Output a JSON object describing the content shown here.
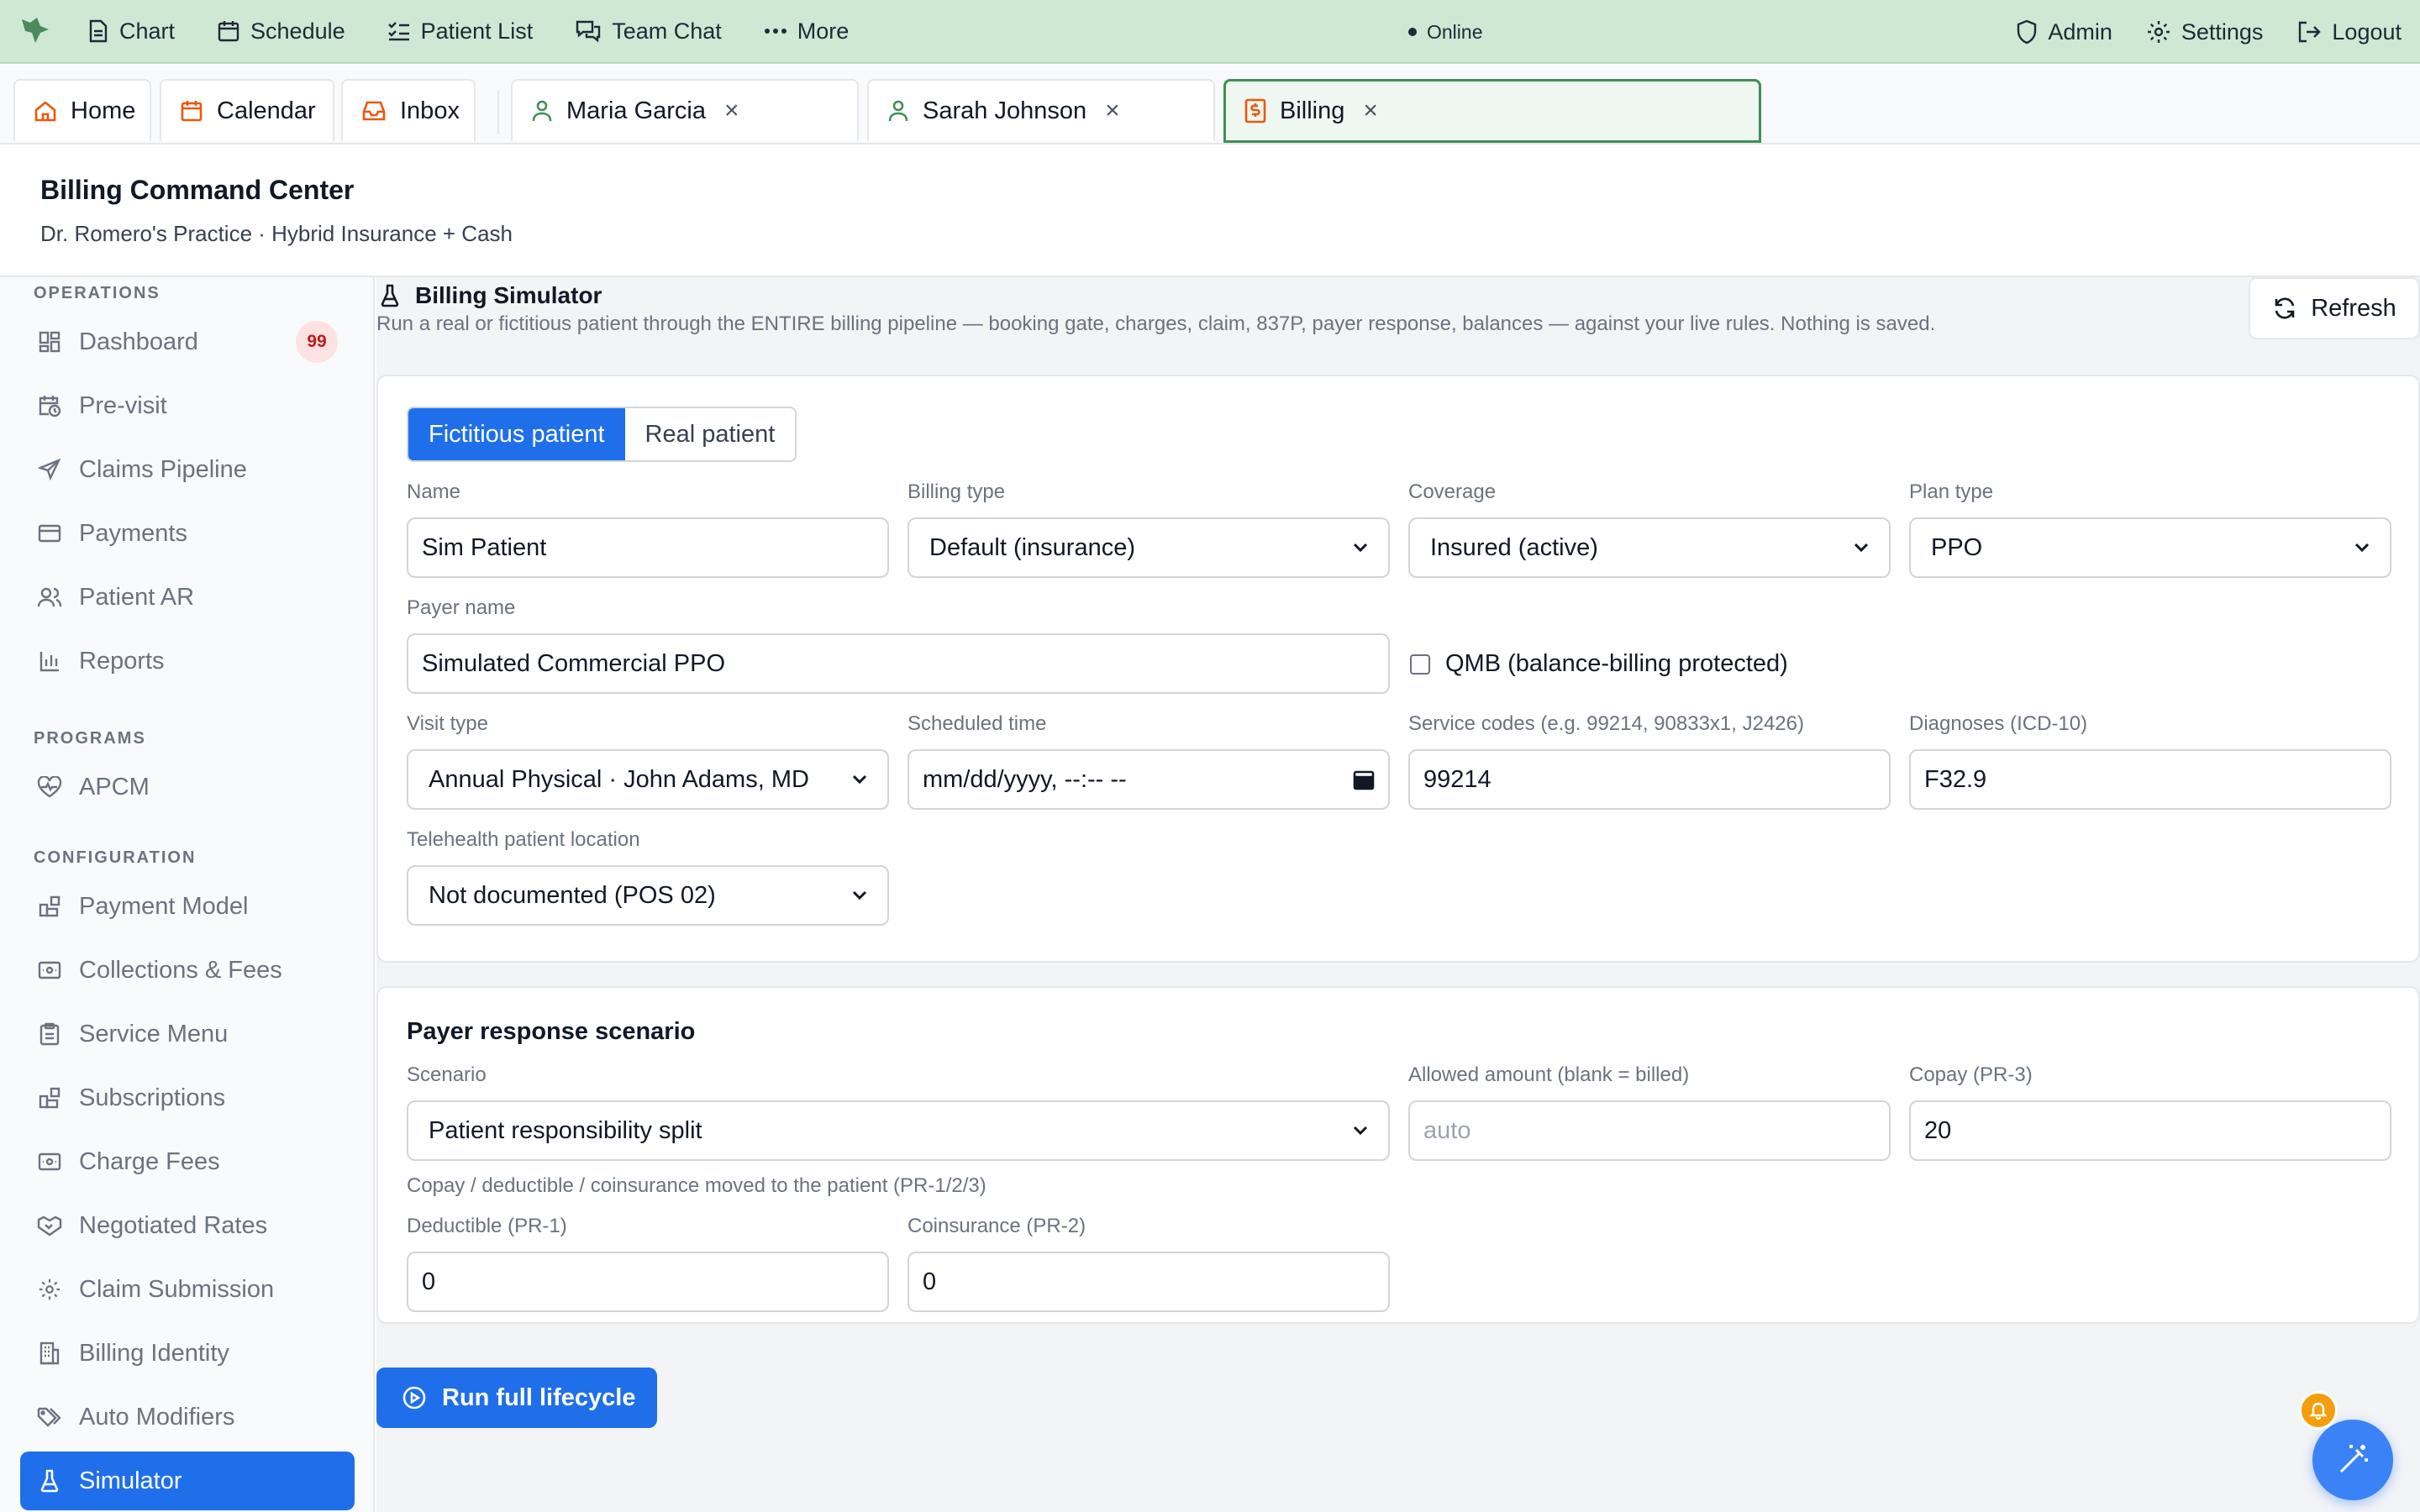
{
  "topnav": {
    "items": [
      {
        "label": "Chart",
        "icon": "document-icon"
      },
      {
        "label": "Schedule",
        "icon": "calendar-icon"
      },
      {
        "label": "Patient List",
        "icon": "list-icon"
      },
      {
        "label": "Team Chat",
        "icon": "chat-icon"
      },
      {
        "label": "More",
        "icon": "dots-icon"
      }
    ],
    "status": "Online",
    "right": [
      {
        "label": "Admin",
        "icon": "shield-icon"
      },
      {
        "label": "Settings",
        "icon": "gear-icon"
      },
      {
        "label": "Logout",
        "icon": "logout-icon"
      }
    ]
  },
  "tabs": {
    "home": "Home",
    "calendar": "Calendar",
    "inbox": "Inbox",
    "patient1": "Maria Garcia",
    "patient2": "Sarah Johnson",
    "billing": "Billing",
    "close": "×"
  },
  "header": {
    "title": "Billing Command Center",
    "subtitle": "Dr. Romero's Practice · Hybrid Insurance + Cash"
  },
  "sidebar": {
    "sections": {
      "operations": "OPERATIONS",
      "programs": "PROGRAMS",
      "configuration": "CONFIGURATION"
    },
    "items": {
      "dashboard": "Dashboard",
      "dashboard_badge": "99",
      "previsit": "Pre-visit",
      "claims": "Claims Pipeline",
      "payments": "Payments",
      "patient_ar": "Patient AR",
      "reports": "Reports",
      "apcm": "APCM",
      "payment_model": "Payment Model",
      "collections": "Collections & Fees",
      "service_menu": "Service Menu",
      "subscriptions": "Subscriptions",
      "charge_fees": "Charge Fees",
      "negotiated_rates": "Negotiated Rates",
      "claim_submission": "Claim Submission",
      "billing_identity": "Billing Identity",
      "auto_modifiers": "Auto Modifiers",
      "simulator": "Simulator"
    }
  },
  "simulator": {
    "title": "Billing Simulator",
    "description": "Run a real or fictitious patient through the ENTIRE billing pipeline — booking gate, charges, claim, 837P, payer response, balances — against your live rules. Nothing is saved.",
    "refresh": "Refresh",
    "toggle": {
      "fictitious": "Fictitious patient",
      "real": "Real patient"
    },
    "fields": {
      "name": {
        "label": "Name",
        "value": "Sim Patient"
      },
      "billing_type": {
        "label": "Billing type",
        "value": "Default (insurance)"
      },
      "coverage": {
        "label": "Coverage",
        "value": "Insured (active)"
      },
      "plan_type": {
        "label": "Plan type",
        "value": "PPO"
      },
      "payer_name": {
        "label": "Payer name",
        "value": "Simulated Commercial PPO"
      },
      "qmb": {
        "label": "QMB (balance-billing protected)"
      },
      "visit_type": {
        "label": "Visit type",
        "value": "Annual Physical · John Adams, MD"
      },
      "scheduled_time": {
        "label": "Scheduled time",
        "value": "mm/dd/yyyy, --:-- --"
      },
      "service_codes": {
        "label": "Service codes (e.g. 99214, 90833x1, J2426)",
        "value": "99214"
      },
      "diagnoses": {
        "label": "Diagnoses (ICD-10)",
        "value": "F32.9"
      },
      "telehealth": {
        "label": "Telehealth patient location",
        "value": "Not documented (POS 02)"
      }
    },
    "payer": {
      "title": "Payer response scenario",
      "scenario": {
        "label": "Scenario",
        "value": "Patient responsibility split"
      },
      "scenario_hint": "Copay / deductible / coinsurance moved to the patient (PR-1/2/3)",
      "allowed": {
        "label": "Allowed amount (blank = billed)",
        "placeholder": "auto"
      },
      "copay": {
        "label": "Copay (PR-3)",
        "value": "20"
      },
      "deductible": {
        "label": "Deductible (PR-1)",
        "value": "0"
      },
      "coinsurance": {
        "label": "Coinsurance (PR-2)",
        "value": "0"
      }
    },
    "run": "Run full lifecycle"
  }
}
